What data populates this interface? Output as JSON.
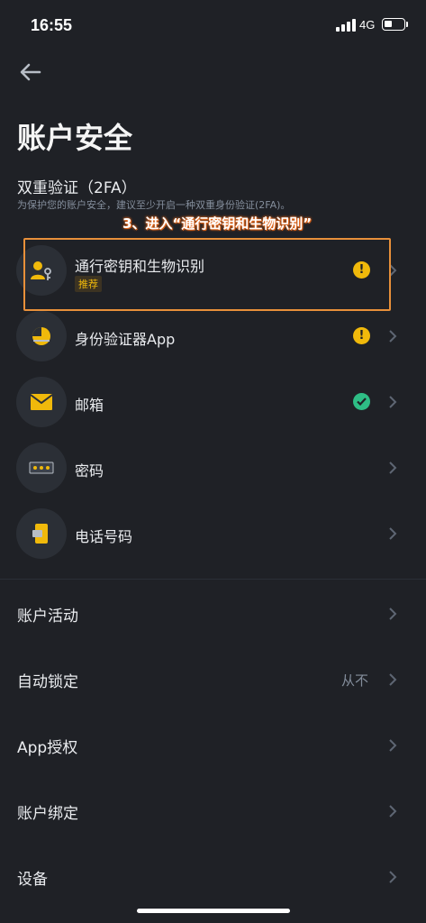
{
  "status_bar": {
    "time": "16:55",
    "network": "4G"
  },
  "page": {
    "title": "账户安全"
  },
  "two_fa": {
    "title": "双重验证（2FA）",
    "description": "为保护您的账户安全，建议至少开启一种双重身份验证(2FA)。",
    "annotation": "3、进入“通行密钥和生物识别”",
    "items": [
      {
        "label": "通行密钥和生物识别",
        "tag": "推荐",
        "status": "warning",
        "icon": "passkey-biometric-icon"
      },
      {
        "label": "身份验证器App",
        "status": "warning",
        "icon": "authenticator-icon"
      },
      {
        "label": "邮箱",
        "status": "verified",
        "icon": "email-icon"
      },
      {
        "label": "密码",
        "status": "none",
        "icon": "password-icon"
      },
      {
        "label": "电话号码",
        "status": "none",
        "icon": "phone-icon"
      }
    ]
  },
  "menu": {
    "items": [
      {
        "label": "账户活动"
      },
      {
        "label": "自动锁定",
        "value": "从不"
      },
      {
        "label": "App授权"
      },
      {
        "label": "账户绑定"
      },
      {
        "label": "设备"
      }
    ]
  },
  "colors": {
    "accent": "#f0b90b",
    "success": "#2ebd85",
    "highlight": "#e8903a",
    "background": "#1f2126"
  }
}
